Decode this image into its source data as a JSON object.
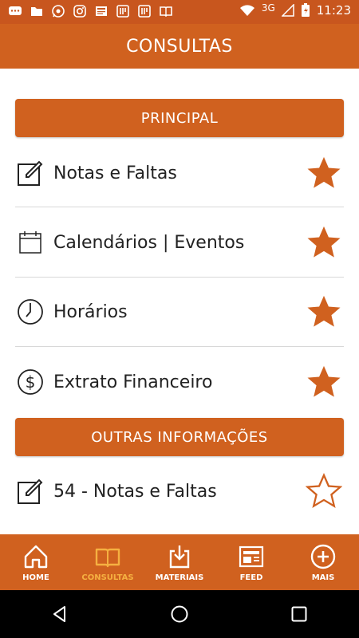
{
  "status_bar": {
    "network": "3G",
    "time": "11:23",
    "icons": [
      "messages-icon",
      "folder-icon",
      "whatsapp-icon",
      "instagram-icon",
      "news-icon",
      "tasks-icon",
      "tasks-icon",
      "book-icon",
      "wifi-icon",
      "signal-icon",
      "battery-icon"
    ]
  },
  "header": {
    "title": "CONSULTAS"
  },
  "sections": [
    {
      "label": "PRINCIPAL"
    },
    {
      "label": "OUTRAS INFORMAÇÕES"
    }
  ],
  "items": [
    {
      "label": "Notas e Faltas",
      "icon": "edit-icon",
      "favorite": true
    },
    {
      "label": "Calendários | Eventos",
      "icon": "calendar-icon",
      "favorite": true
    },
    {
      "label": "Horários",
      "icon": "clock-icon",
      "favorite": true
    },
    {
      "label": "Extrato Financeiro",
      "icon": "dollar-icon",
      "favorite": true
    },
    {
      "label": "54 - Notas e Faltas",
      "icon": "edit-icon",
      "favorite": false
    }
  ],
  "bottom_nav": [
    {
      "label": "HOME",
      "icon": "home-icon"
    },
    {
      "label": "CONSULTAS",
      "icon": "book-icon",
      "active": true
    },
    {
      "label": "MATERIAIS",
      "icon": "download-icon"
    },
    {
      "label": "FEED",
      "icon": "news-icon"
    },
    {
      "label": "MAIS",
      "icon": "plus-circle-icon"
    }
  ],
  "colors": {
    "primary": "#d0611f",
    "status_bar": "#c8561e",
    "active_nav": "#f5b041",
    "star": "#d0611f"
  }
}
